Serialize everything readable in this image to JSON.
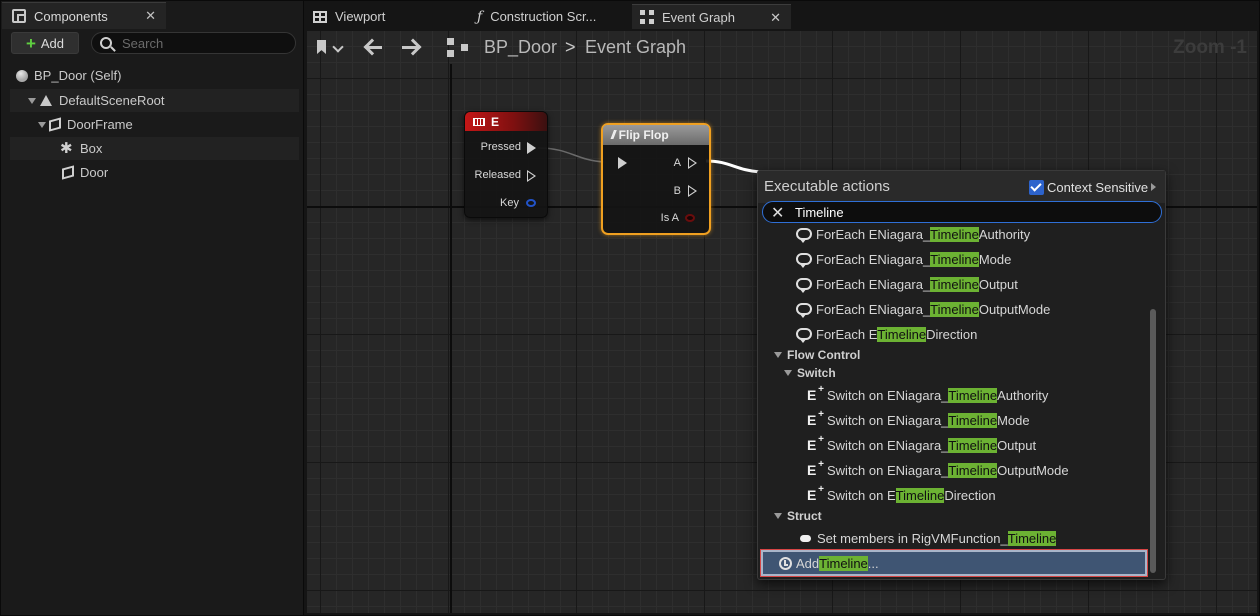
{
  "components_panel": {
    "tab_label": "Components",
    "close_glyph": "✕",
    "add_label": "Add",
    "search_placeholder": "Search",
    "tree": [
      {
        "label": "BP_Door (Self)"
      },
      {
        "label": "DefaultSceneRoot"
      },
      {
        "label": "DoorFrame"
      },
      {
        "label": "Box"
      },
      {
        "label": "Door"
      }
    ]
  },
  "editor_tabs": [
    {
      "label": "Viewport"
    },
    {
      "label": "Construction Scr..."
    },
    {
      "label": "Event Graph",
      "close_glyph": "✕"
    }
  ],
  "graph_toolbar": {
    "breadcrumb_root": "BP_Door",
    "breadcrumb_sep": ">",
    "breadcrumb_leaf": "Event Graph",
    "zoom": "Zoom -1"
  },
  "nodes": {
    "key_event": {
      "title": "E",
      "pins": {
        "pressed": "Pressed",
        "released": "Released",
        "key": "Key"
      }
    },
    "flip_flop": {
      "title": "Flip Flop",
      "pins": {
        "a": "A",
        "b": "B",
        "is_a": "Is A"
      }
    }
  },
  "action_menu": {
    "title": "Executable actions",
    "context_label": "Context Sensitive",
    "context_checked": true,
    "search_value": "Timeline",
    "clear_glyph": "✕",
    "highlight_color": "#6cb233",
    "foreach_items": [
      {
        "pre": "ForEach ENiagara_",
        "hl": "Timeline",
        "post": "Authority"
      },
      {
        "pre": "ForEach ENiagara_",
        "hl": "Timeline",
        "post": "Mode"
      },
      {
        "pre": "ForEach ENiagara_",
        "hl": "Timeline",
        "post": "Output"
      },
      {
        "pre": "ForEach ENiagara_",
        "hl": "Timeline",
        "post": "OutputMode"
      },
      {
        "pre": "ForEach E",
        "hl": "Timeline",
        "post": "Direction"
      }
    ],
    "category_flow": "Flow Control",
    "category_switch": "Switch",
    "switch_items": [
      {
        "pre": "Switch on ENiagara_",
        "hl": "Timeline",
        "post": "Authority"
      },
      {
        "pre": "Switch on ENiagara_",
        "hl": "Timeline",
        "post": "Mode"
      },
      {
        "pre": "Switch on ENiagara_",
        "hl": "Timeline",
        "post": "Output"
      },
      {
        "pre": "Switch on ENiagara_",
        "hl": "Timeline",
        "post": "OutputMode"
      },
      {
        "pre": "Switch on E",
        "hl": "Timeline",
        "post": "Direction"
      }
    ],
    "category_struct": "Struct",
    "struct_item": {
      "pre": "Set members in RigVMFunction_",
      "hl": "Timeline",
      "post": ""
    },
    "add_item": {
      "pre": "Add ",
      "hl": "Timeline",
      "post": "..."
    }
  }
}
